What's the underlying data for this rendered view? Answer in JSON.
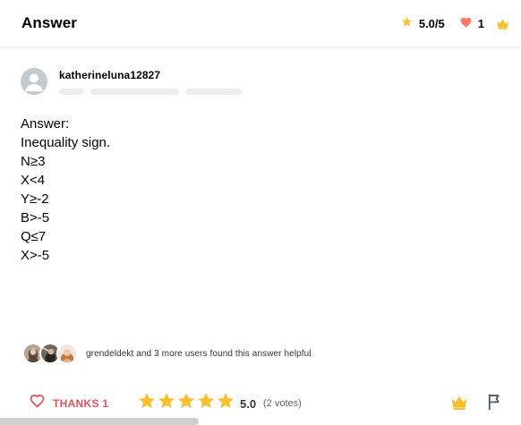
{
  "header": {
    "title": "Answer",
    "rating": "5.0/5",
    "hearts": "1"
  },
  "author": {
    "username": "katherineluna12827"
  },
  "answer": {
    "lines": [
      "Answer:",
      "Inequality sign.",
      "N≥3",
      "X<4",
      "Y≥-2",
      "B>-5",
      "Q≤7",
      "X>-5"
    ]
  },
  "helpful": {
    "text": "grendeldekt and 3 more users found this answer helpful"
  },
  "footer": {
    "thanks_label": "THANKS 1",
    "score": "5.0",
    "votes": "(2 votes)",
    "stars_filled": 5
  },
  "colors": {
    "star": "#fbbe2e",
    "heart": "#ff7968",
    "thanks": "#e0525b",
    "crown": "#fbbe2e",
    "flag": "#4a5a6b"
  }
}
